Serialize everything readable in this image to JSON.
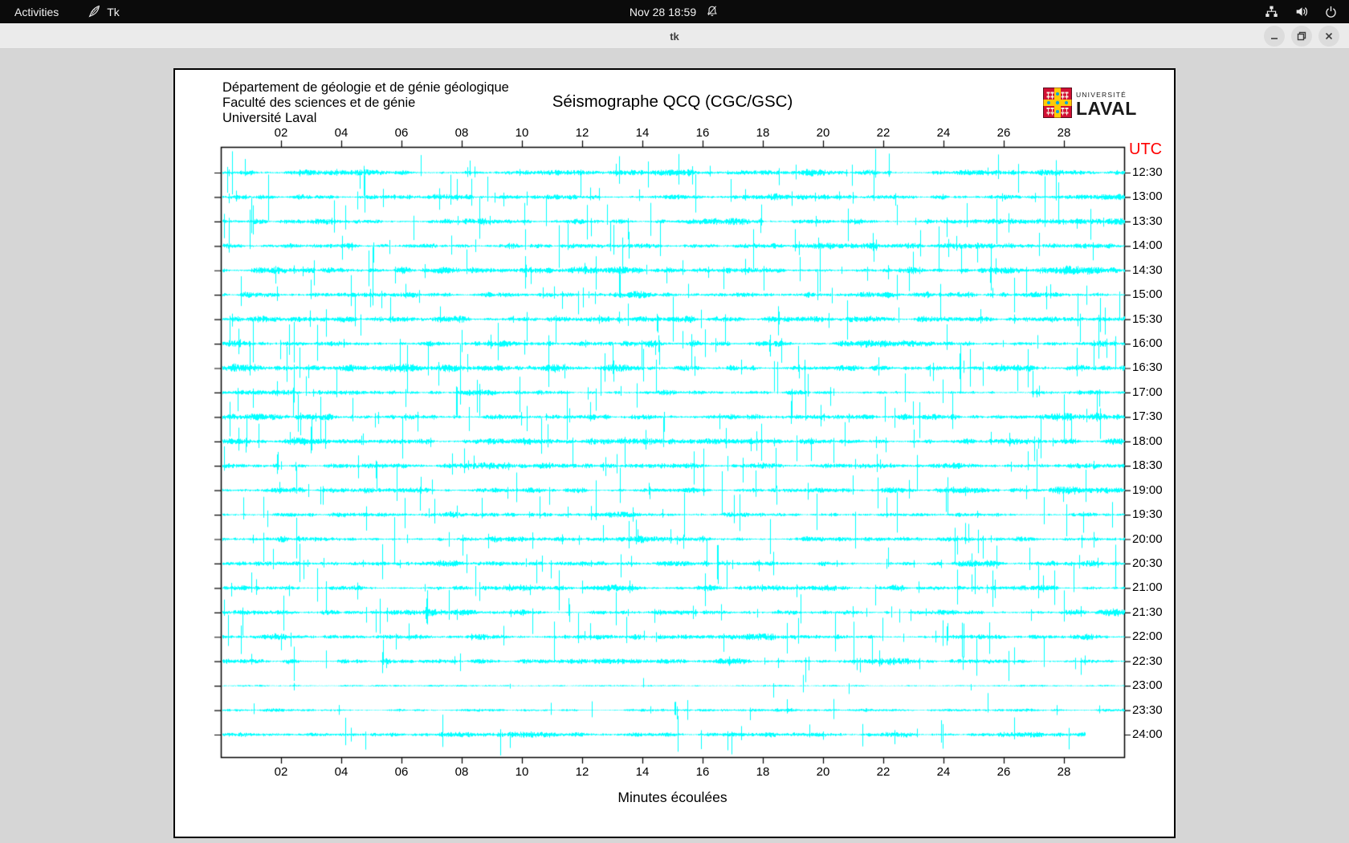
{
  "top_bar": {
    "activities_label": "Activities",
    "app_name": "Tk",
    "clock": "Nov 28 18:59",
    "icons": [
      "tk-feather-icon",
      "notifications-disabled-icon",
      "network-icon",
      "volume-icon",
      "power-icon"
    ]
  },
  "window": {
    "title": "tk",
    "controls": [
      "minimize",
      "restore",
      "close"
    ]
  },
  "page_header": {
    "line1": "Département de géologie et de génie géologique",
    "line2": "Faculté des sciences et de génie",
    "line3": "Université Laval"
  },
  "logo": {
    "top_text": "UNIVERSITÉ",
    "bottom_text": "LAVAL",
    "shield_red": "#d21034",
    "shield_yellow": "#ffcb05",
    "shield_blue": "#0aa2dc"
  },
  "colors": {
    "trace": "#00ffff",
    "utc_label": "#ff0000",
    "frame": "#000000",
    "canvas_bg": "#ffffff",
    "desktop_bg": "#d6d6d6",
    "topbar_bg": "#0b0b0b",
    "titlebar_bg": "#ebebeb"
  },
  "chart_data": {
    "type": "line",
    "subtype": "seismogram-helicorder",
    "title": "Séismographe QCQ (CGC/GSC)",
    "xlabel": "Minutes écoulées",
    "right_axis_title": "UTC",
    "xlim": [
      0,
      30
    ],
    "x_tick_minutes": [
      2,
      4,
      6,
      8,
      10,
      12,
      14,
      16,
      18,
      20,
      22,
      24,
      26,
      28
    ],
    "x_tick_labels": [
      "02",
      "04",
      "06",
      "08",
      "10",
      "12",
      "14",
      "16",
      "18",
      "20",
      "22",
      "24",
      "26",
      "28"
    ],
    "grid": false,
    "trace_color": "#00ffff",
    "traces": [
      {
        "utc": "12:30",
        "amplitude": 0.95,
        "spikes": 30,
        "end_minute": 30
      },
      {
        "utc": "13:00",
        "amplitude": 1.0,
        "spikes": 32,
        "end_minute": 30
      },
      {
        "utc": "13:30",
        "amplitude": 1.05,
        "spikes": 34,
        "end_minute": 30
      },
      {
        "utc": "14:00",
        "amplitude": 1.0,
        "spikes": 30,
        "end_minute": 30
      },
      {
        "utc": "14:30",
        "amplitude": 1.25,
        "spikes": 36,
        "end_minute": 30
      },
      {
        "utc": "15:00",
        "amplitude": 1.0,
        "spikes": 30,
        "end_minute": 30
      },
      {
        "utc": "15:30",
        "amplitude": 1.1,
        "spikes": 32,
        "end_minute": 30
      },
      {
        "utc": "16:00",
        "amplitude": 1.15,
        "spikes": 34,
        "end_minute": 30
      },
      {
        "utc": "16:30",
        "amplitude": 1.3,
        "spikes": 38,
        "end_minute": 30
      },
      {
        "utc": "17:00",
        "amplitude": 1.0,
        "spikes": 30,
        "end_minute": 30
      },
      {
        "utc": "17:30",
        "amplitude": 1.1,
        "spikes": 34,
        "end_minute": 30
      },
      {
        "utc": "18:00",
        "amplitude": 1.15,
        "spikes": 36,
        "end_minute": 30
      },
      {
        "utc": "18:30",
        "amplitude": 1.0,
        "spikes": 30,
        "end_minute": 30
      },
      {
        "utc": "19:00",
        "amplitude": 1.0,
        "spikes": 32,
        "end_minute": 30
      },
      {
        "utc": "19:30",
        "amplitude": 0.9,
        "spikes": 28,
        "end_minute": 30
      },
      {
        "utc": "20:00",
        "amplitude": 1.0,
        "spikes": 30,
        "end_minute": 30
      },
      {
        "utc": "20:30",
        "amplitude": 1.05,
        "spikes": 34,
        "end_minute": 30
      },
      {
        "utc": "21:00",
        "amplitude": 1.0,
        "spikes": 32,
        "end_minute": 30
      },
      {
        "utc": "21:30",
        "amplitude": 1.0,
        "spikes": 34,
        "end_minute": 30
      },
      {
        "utc": "22:00",
        "amplitude": 1.0,
        "spikes": 30,
        "end_minute": 30
      },
      {
        "utc": "22:30",
        "amplitude": 1.0,
        "spikes": 28,
        "end_minute": 30
      },
      {
        "utc": "23:00",
        "amplitude": 0.35,
        "spikes": 8,
        "end_minute": 30
      },
      {
        "utc": "23:30",
        "amplitude": 0.6,
        "spikes": 16,
        "end_minute": 30
      },
      {
        "utc": "24:00",
        "amplitude": 0.8,
        "spikes": 20,
        "end_minute": 28.7
      }
    ]
  }
}
